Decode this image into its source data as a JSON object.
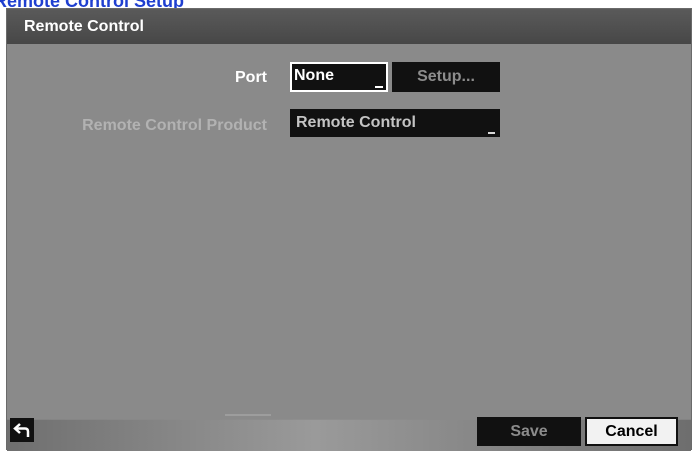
{
  "page_header": {
    "text": "Remote Control Setup"
  },
  "dialog": {
    "title": "Remote Control",
    "port": {
      "label": "Port",
      "value": "None",
      "setup_label": "Setup..."
    },
    "remote_control_product": {
      "label": "Remote Control Product",
      "value": "Remote Control"
    },
    "footer": {
      "back_icon": "back-arrow-icon",
      "save_label": "Save",
      "cancel_label": "Cancel"
    }
  },
  "colors": {
    "panel": "#8a8a8a",
    "title_bar": "#4f4f4f",
    "control_bg": "#111111",
    "disabled_text": "#8c8c8c",
    "header_blue": "#1f3fd0"
  }
}
